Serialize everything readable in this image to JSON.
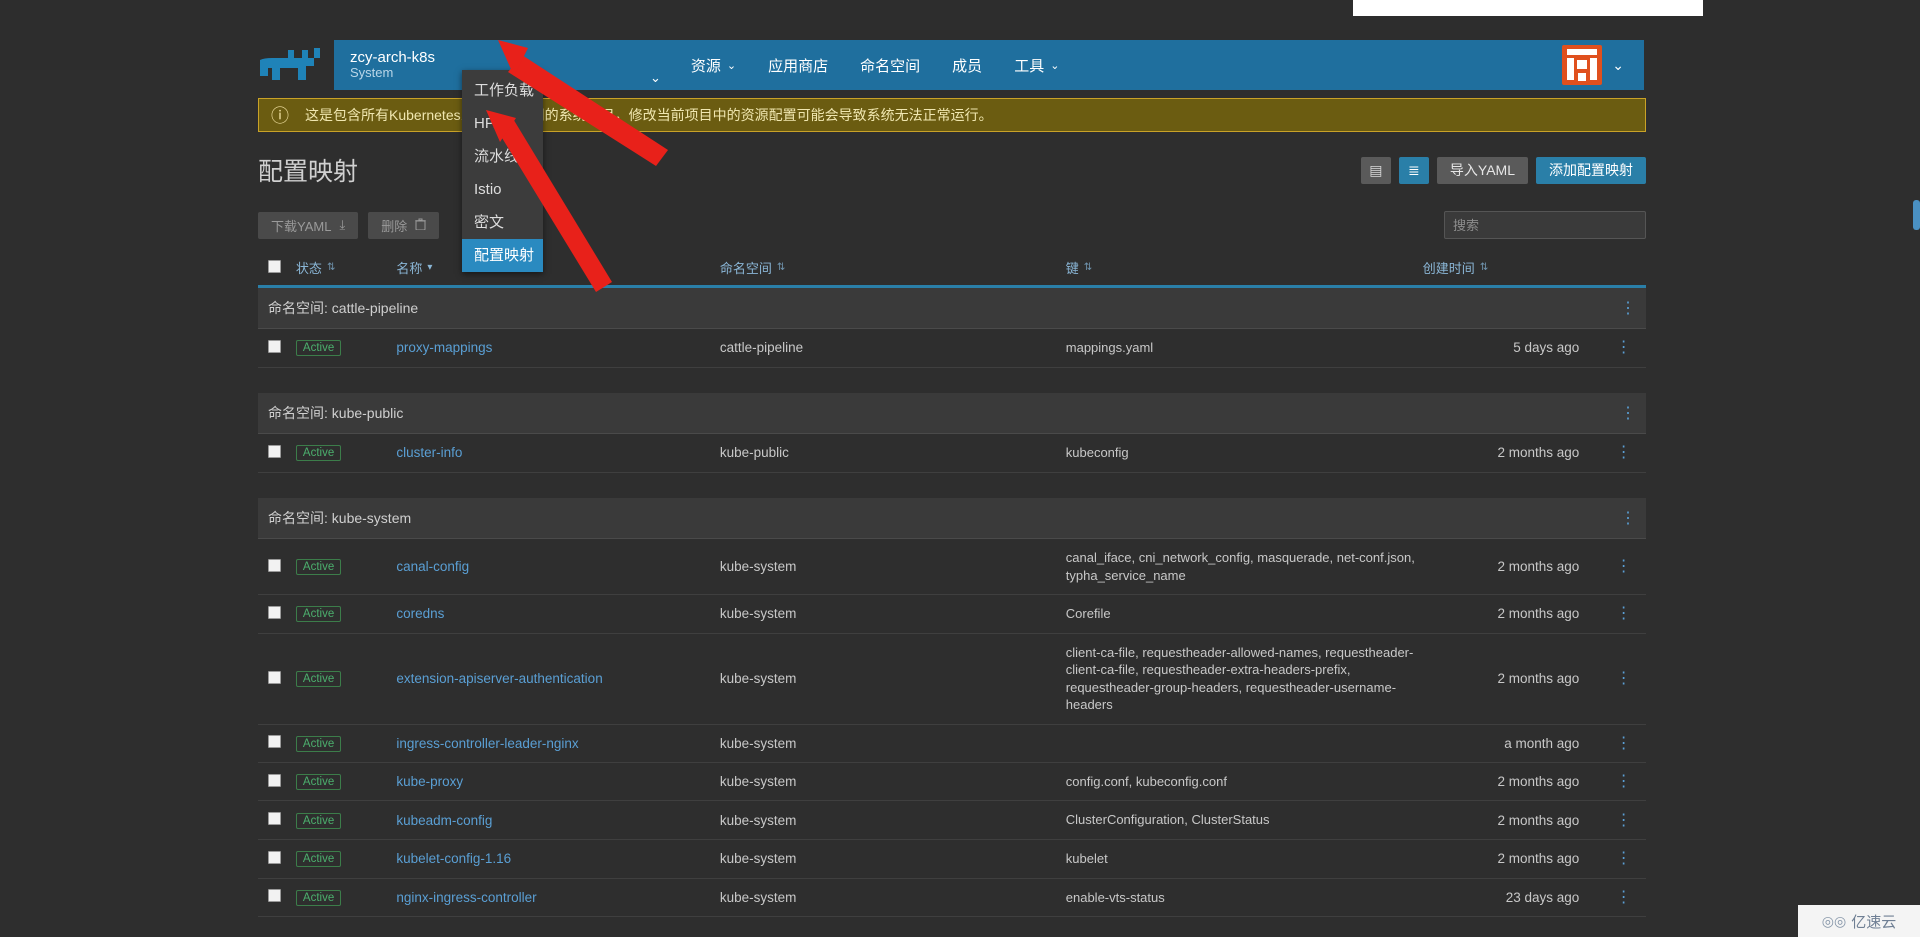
{
  "header": {
    "cluster_name": "zcy-arch-k8s",
    "cluster_sub": "System",
    "cluster_caret": "⌄",
    "nav_items": [
      {
        "label": "资源",
        "caret": "⌄",
        "open": true
      },
      {
        "label": "应用商店",
        "caret": "",
        "open": false
      },
      {
        "label": "命名空间",
        "caret": "",
        "open": false
      },
      {
        "label": "成员",
        "caret": "",
        "open": false
      },
      {
        "label": "工具",
        "caret": "⌄",
        "open": false
      }
    ],
    "avatar_caret": "⌄",
    "logo_name": "rancher-cow-logo",
    "avatar_name": "user-avatar"
  },
  "dropdown": {
    "items": [
      {
        "label": "工作负载",
        "active": false
      },
      {
        "label": "HPA",
        "active": false
      },
      {
        "label": "流水线",
        "active": false
      },
      {
        "label": "Istio",
        "active": false
      },
      {
        "label": "密文",
        "active": false
      },
      {
        "label": "配置映射",
        "active": true
      }
    ]
  },
  "warning": {
    "icon": "ⓘ",
    "text": "这是包含所有Kubernetes系统命名空间的系统项目，修改当前项目中的资源配置可能会导致系统无法正常运行。"
  },
  "page": {
    "title": "配置映射",
    "actions": {
      "doc_icon": "▤",
      "list_icon": "≣",
      "import_yaml": "导入YAML",
      "add_configmap": "添加配置映射"
    },
    "toolbar": {
      "download_yaml": "下载YAML",
      "download_icon": "⤓",
      "delete": "删除",
      "delete_icon": "Ὕ1",
      "search_placeholder": "搜索",
      "search_value": ""
    }
  },
  "table": {
    "headers": [
      {
        "label": "状态",
        "sort": "⇅"
      },
      {
        "label": "名称",
        "sort": "▾"
      },
      {
        "label": "命名空间",
        "sort": "⇅"
      },
      {
        "label": "键",
        "sort": "⇅"
      },
      {
        "label": "创建时间",
        "sort": "⇅"
      }
    ],
    "group_prefix": "命名空间:",
    "kebab": "⋮",
    "groups": [
      {
        "namespace": "cattle-pipeline",
        "rows": [
          {
            "status": "Active",
            "name": "proxy-mappings",
            "namespace": "cattle-pipeline",
            "keys": "mappings.yaml",
            "created": "5 days ago"
          }
        ]
      },
      {
        "namespace": "kube-public",
        "rows": [
          {
            "status": "Active",
            "name": "cluster-info",
            "namespace": "kube-public",
            "keys": "kubeconfig",
            "created": "2 months ago"
          }
        ]
      },
      {
        "namespace": "kube-system",
        "rows": [
          {
            "status": "Active",
            "name": "canal-config",
            "namespace": "kube-system",
            "keys": "canal_iface, cni_network_config, masquerade, net-conf.json, typha_service_name",
            "created": "2 months ago"
          },
          {
            "status": "Active",
            "name": "coredns",
            "namespace": "kube-system",
            "keys": "Corefile",
            "created": "2 months ago"
          },
          {
            "status": "Active",
            "name": "extension-apiserver-authentication",
            "namespace": "kube-system",
            "keys": "client-ca-file, requestheader-allowed-names, requestheader-client-ca-file, requestheader-extra-headers-prefix, requestheader-group-headers, requestheader-username-headers",
            "created": "2 months ago"
          },
          {
            "status": "Active",
            "name": "ingress-controller-leader-nginx",
            "namespace": "kube-system",
            "keys": "",
            "created": "a month ago"
          },
          {
            "status": "Active",
            "name": "kube-proxy",
            "namespace": "kube-system",
            "keys": "config.conf, kubeconfig.conf",
            "created": "2 months ago"
          },
          {
            "status": "Active",
            "name": "kubeadm-config",
            "namespace": "kube-system",
            "keys": "ClusterConfiguration, ClusterStatus",
            "created": "2 months ago"
          },
          {
            "status": "Active",
            "name": "kubelet-config-1.16",
            "namespace": "kube-system",
            "keys": "kubelet",
            "created": "2 months ago"
          },
          {
            "status": "Active",
            "name": "nginx-ingress-controller",
            "namespace": "kube-system",
            "keys": "enable-vts-status",
            "created": "23 days ago"
          }
        ]
      }
    ]
  },
  "watermark": {
    "text": "亿速云",
    "icon": "◎◎"
  },
  "colors": {
    "nav_blue": "#1f6f9e",
    "accent_blue": "#2a7fa8",
    "link_blue": "#5a9fd4",
    "warning_bg": "#6b5c11",
    "warning_border": "#c9a227",
    "badge_green": "#4caf6d",
    "arrow_red": "#e8211a"
  }
}
